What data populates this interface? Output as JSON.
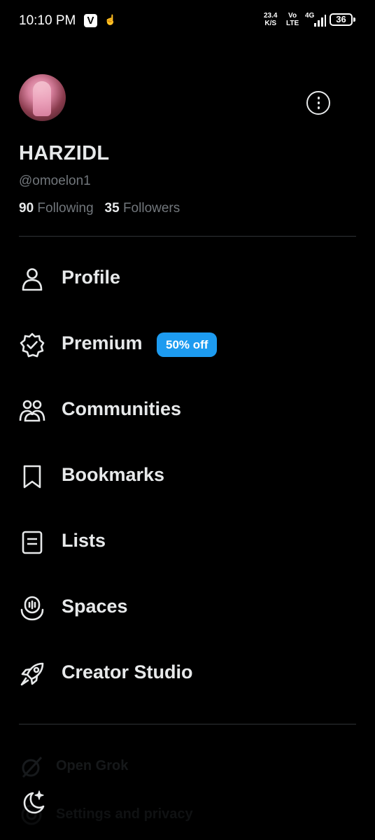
{
  "status_bar": {
    "time": "10:10 PM",
    "app_icon": "V",
    "net_speed_value": "23.4",
    "net_speed_unit": "K/S",
    "volte_top": "Vo",
    "volte_bottom": "LTE",
    "network": "4G",
    "battery": "36"
  },
  "profile": {
    "display_name": "HARZIDL",
    "handle": "@omoelon1",
    "following_count": "90",
    "following_label": "Following",
    "followers_count": "35",
    "followers_label": "Followers"
  },
  "menu": {
    "profile": "Profile",
    "premium": "Premium",
    "premium_badge": "50% off",
    "communities": "Communities",
    "bookmarks": "Bookmarks",
    "lists": "Lists",
    "spaces": "Spaces",
    "creator_studio": "Creator Studio"
  },
  "bottom": {
    "open_grok": "Open Grok",
    "settings": "Settings and privacy"
  },
  "colors": {
    "background": "#000000",
    "text": "#e7e9ea",
    "muted": "#71767b",
    "accent": "#1d9bf0",
    "divider": "#2f3336"
  }
}
